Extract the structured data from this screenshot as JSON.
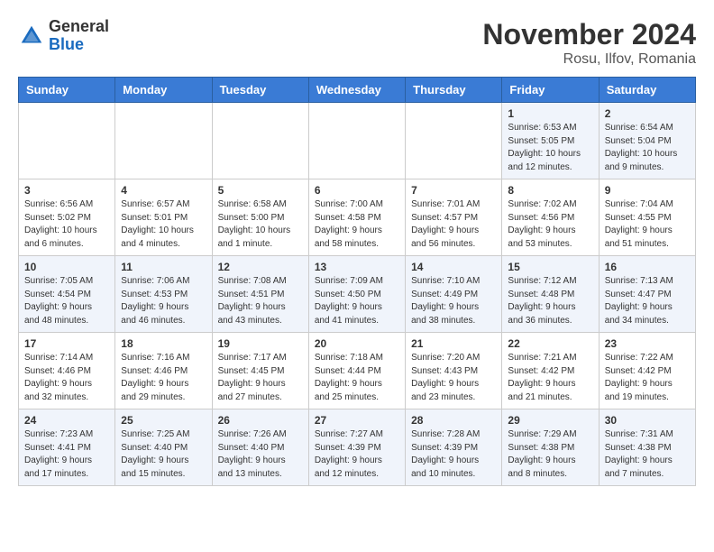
{
  "header": {
    "logo_general": "General",
    "logo_blue": "Blue",
    "month_year": "November 2024",
    "location": "Rosu, Ilfov, Romania"
  },
  "weekdays": [
    "Sunday",
    "Monday",
    "Tuesday",
    "Wednesday",
    "Thursday",
    "Friday",
    "Saturday"
  ],
  "weeks": [
    [
      {
        "day": "",
        "info": ""
      },
      {
        "day": "",
        "info": ""
      },
      {
        "day": "",
        "info": ""
      },
      {
        "day": "",
        "info": ""
      },
      {
        "day": "",
        "info": ""
      },
      {
        "day": "1",
        "info": "Sunrise: 6:53 AM\nSunset: 5:05 PM\nDaylight: 10 hours and 12 minutes."
      },
      {
        "day": "2",
        "info": "Sunrise: 6:54 AM\nSunset: 5:04 PM\nDaylight: 10 hours and 9 minutes."
      }
    ],
    [
      {
        "day": "3",
        "info": "Sunrise: 6:56 AM\nSunset: 5:02 PM\nDaylight: 10 hours and 6 minutes."
      },
      {
        "day": "4",
        "info": "Sunrise: 6:57 AM\nSunset: 5:01 PM\nDaylight: 10 hours and 4 minutes."
      },
      {
        "day": "5",
        "info": "Sunrise: 6:58 AM\nSunset: 5:00 PM\nDaylight: 10 hours and 1 minute."
      },
      {
        "day": "6",
        "info": "Sunrise: 7:00 AM\nSunset: 4:58 PM\nDaylight: 9 hours and 58 minutes."
      },
      {
        "day": "7",
        "info": "Sunrise: 7:01 AM\nSunset: 4:57 PM\nDaylight: 9 hours and 56 minutes."
      },
      {
        "day": "8",
        "info": "Sunrise: 7:02 AM\nSunset: 4:56 PM\nDaylight: 9 hours and 53 minutes."
      },
      {
        "day": "9",
        "info": "Sunrise: 7:04 AM\nSunset: 4:55 PM\nDaylight: 9 hours and 51 minutes."
      }
    ],
    [
      {
        "day": "10",
        "info": "Sunrise: 7:05 AM\nSunset: 4:54 PM\nDaylight: 9 hours and 48 minutes."
      },
      {
        "day": "11",
        "info": "Sunrise: 7:06 AM\nSunset: 4:53 PM\nDaylight: 9 hours and 46 minutes."
      },
      {
        "day": "12",
        "info": "Sunrise: 7:08 AM\nSunset: 4:51 PM\nDaylight: 9 hours and 43 minutes."
      },
      {
        "day": "13",
        "info": "Sunrise: 7:09 AM\nSunset: 4:50 PM\nDaylight: 9 hours and 41 minutes."
      },
      {
        "day": "14",
        "info": "Sunrise: 7:10 AM\nSunset: 4:49 PM\nDaylight: 9 hours and 38 minutes."
      },
      {
        "day": "15",
        "info": "Sunrise: 7:12 AM\nSunset: 4:48 PM\nDaylight: 9 hours and 36 minutes."
      },
      {
        "day": "16",
        "info": "Sunrise: 7:13 AM\nSunset: 4:47 PM\nDaylight: 9 hours and 34 minutes."
      }
    ],
    [
      {
        "day": "17",
        "info": "Sunrise: 7:14 AM\nSunset: 4:46 PM\nDaylight: 9 hours and 32 minutes."
      },
      {
        "day": "18",
        "info": "Sunrise: 7:16 AM\nSunset: 4:46 PM\nDaylight: 9 hours and 29 minutes."
      },
      {
        "day": "19",
        "info": "Sunrise: 7:17 AM\nSunset: 4:45 PM\nDaylight: 9 hours and 27 minutes."
      },
      {
        "day": "20",
        "info": "Sunrise: 7:18 AM\nSunset: 4:44 PM\nDaylight: 9 hours and 25 minutes."
      },
      {
        "day": "21",
        "info": "Sunrise: 7:20 AM\nSunset: 4:43 PM\nDaylight: 9 hours and 23 minutes."
      },
      {
        "day": "22",
        "info": "Sunrise: 7:21 AM\nSunset: 4:42 PM\nDaylight: 9 hours and 21 minutes."
      },
      {
        "day": "23",
        "info": "Sunrise: 7:22 AM\nSunset: 4:42 PM\nDaylight: 9 hours and 19 minutes."
      }
    ],
    [
      {
        "day": "24",
        "info": "Sunrise: 7:23 AM\nSunset: 4:41 PM\nDaylight: 9 hours and 17 minutes."
      },
      {
        "day": "25",
        "info": "Sunrise: 7:25 AM\nSunset: 4:40 PM\nDaylight: 9 hours and 15 minutes."
      },
      {
        "day": "26",
        "info": "Sunrise: 7:26 AM\nSunset: 4:40 PM\nDaylight: 9 hours and 13 minutes."
      },
      {
        "day": "27",
        "info": "Sunrise: 7:27 AM\nSunset: 4:39 PM\nDaylight: 9 hours and 12 minutes."
      },
      {
        "day": "28",
        "info": "Sunrise: 7:28 AM\nSunset: 4:39 PM\nDaylight: 9 hours and 10 minutes."
      },
      {
        "day": "29",
        "info": "Sunrise: 7:29 AM\nSunset: 4:38 PM\nDaylight: 9 hours and 8 minutes."
      },
      {
        "day": "30",
        "info": "Sunrise: 7:31 AM\nSunset: 4:38 PM\nDaylight: 9 hours and 7 minutes."
      }
    ]
  ]
}
